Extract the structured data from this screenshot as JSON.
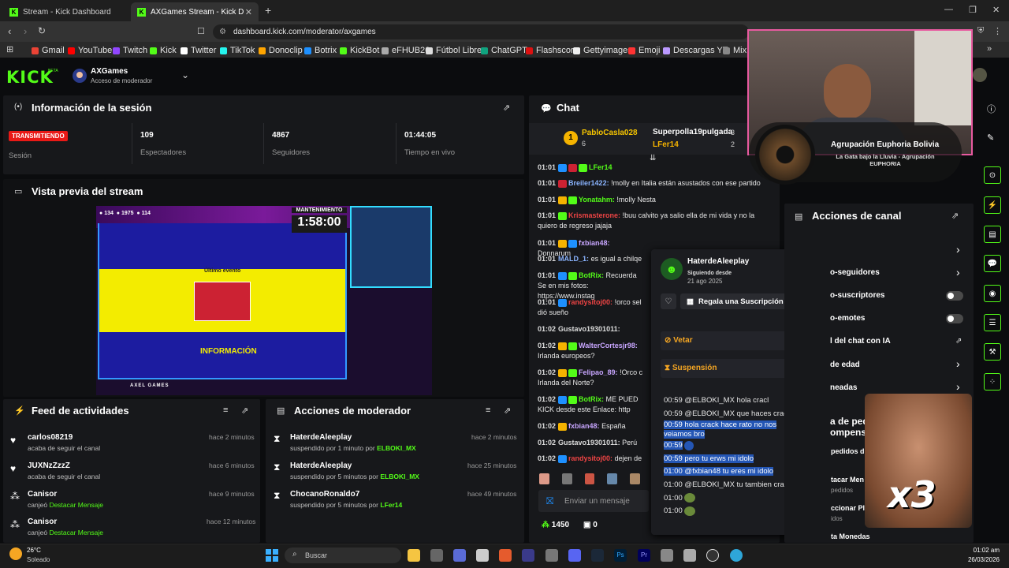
{
  "browser": {
    "tabs": [
      {
        "title": "Stream - Kick Dashboard"
      },
      {
        "title": "AXGames Stream - Kick Dashbo"
      }
    ],
    "url": "dashboard.kick.com/moderator/axgames",
    "bookmarks": [
      "Gmail",
      "YouTube",
      "Twitch",
      "Kick",
      "Twitter",
      "TikTok",
      "Donoclip",
      "Botrix",
      "KickBot",
      "eFHUB26",
      "Fútbol Libre",
      "ChatGPT",
      "Flashscore",
      "Gettyimages",
      "Emoji",
      "Descargas YT",
      "Mix N"
    ]
  },
  "header": {
    "logo": "KICK",
    "logo_tag": "BETA",
    "channel": "AXGames",
    "role": "Acceso de moderador"
  },
  "session": {
    "title": "Información de la sesión",
    "status_badge": "TRANSMITIENDO",
    "status_label": "Sesión",
    "viewers": "109",
    "viewers_label": "Espectadores",
    "followers": "4867",
    "followers_label": "Seguidores",
    "uptime": "01:44:05",
    "uptime_label": "Tiempo en vivo"
  },
  "preview": {
    "title": "Vista previa del stream",
    "stat1": "134",
    "stat2": "1975",
    "stat3": "114",
    "maint_label": "MANTENIMIENTO",
    "maint_timer": "1:58:00",
    "last_event": "Último evento",
    "info": "INFORMACIÓN",
    "footer": "AXEL GAMES"
  },
  "feed": {
    "title": "Feed de actividades",
    "items": [
      {
        "user": "carlos08219",
        "action": "acaba de seguir el canal",
        "highlight": "",
        "time": "hace 2 minutos"
      },
      {
        "user": "JUXNzZzzZ",
        "action": "acaba de seguir el canal",
        "highlight": "",
        "time": "hace 6 minutos"
      },
      {
        "user": "Canisor",
        "action": "canjeó",
        "highlight": "Destacar Mensaje",
        "time": "hace 9 minutos"
      },
      {
        "user": "Canisor",
        "action": "canjeó",
        "highlight": "Destacar Mensaje",
        "time": "hace 12 minutos"
      }
    ]
  },
  "modactions": {
    "title": "Acciones de moderador",
    "items": [
      {
        "user": "HaterdeAleeplay",
        "action": "suspendido por 1 minuto por",
        "by": "ELBOKI_MX",
        "time": "hace 2 minutos"
      },
      {
        "user": "HaterdeAleeplay",
        "action": "suspendido por 5 minutos por",
        "by": "ELBOKI_MX",
        "time": "hace 25 minutos"
      },
      {
        "user": "ChocanoRonaldo7",
        "action": "suspendido por 5 minutos por",
        "by": "LFer14",
        "time": "hace 49 minutos"
      }
    ]
  },
  "chat": {
    "title": "Chat",
    "leaders": {
      "first": "PabloCasla028",
      "first_count": "6",
      "second": "Superpolla19pulgada",
      "second_count": "3",
      "third": "LFer14",
      "third_count": "2"
    },
    "messages": [
      {
        "time": "01:01",
        "user": "LFer14",
        "text": ""
      },
      {
        "time": "01:01",
        "user": "Breiler1422:",
        "text": "!molly en Italia están asustados con ese partido"
      },
      {
        "time": "01:01",
        "user": "Yonatahm:",
        "text": "!molly Nesta"
      },
      {
        "time": "01:01",
        "user": "Krismasterone:",
        "text": "!buu calvito ya salio ella de mi vida y no la quiero de regreso jajaja"
      },
      {
        "time": "01:01",
        "user": "fxbian48:",
        "text": "Donnarum"
      },
      {
        "time": "01:01",
        "user": "MALD_1:",
        "text": "es igual a chilqe"
      },
      {
        "time": "01:01",
        "user": "BotRix:",
        "text": "Recuerda Se en mis fotos: https://www.instag"
      },
      {
        "time": "01:01",
        "user": "randysitoj00:",
        "text": "!orco sel dió sueño"
      },
      {
        "time": "01:02",
        "user": "Gustavo19301011:",
        "text": ""
      },
      {
        "time": "01:02",
        "user": "WalterCortesjr98:",
        "text": "Irlanda europeos?"
      },
      {
        "time": "01:02",
        "user": "Felipao_89:",
        "text": "!Orco c Irlanda del Norte?"
      },
      {
        "time": "01:02",
        "user": "BotRix:",
        "text": "ME PUED KICK desde este Enlace: http"
      },
      {
        "time": "01:02",
        "user": "fxbian48:",
        "text": "España"
      },
      {
        "time": "01:02",
        "user": "Gustavo19301011:",
        "text": "Perú"
      },
      {
        "time": "01:02",
        "user": "randysitoj00:",
        "text": "dejen de"
      }
    ],
    "input_placeholder": "Enviar un mensaje",
    "points": "1450",
    "gifts": "0"
  },
  "usercard": {
    "username": "HaterdeAleeplay",
    "following_label": "Siguiendo desde",
    "following_date": "21 ago 2025",
    "gift_label": "Regala una Suscripción",
    "ban_label": "Vetar",
    "timeout_label": "Suspensión",
    "history": [
      {
        "time": "00:59",
        "text": "@ELBOKI_MX hola cracl"
      },
      {
        "time": "00:59",
        "text": "@ELBOKI_MX que haces crack"
      },
      {
        "time": "00:59",
        "text": "hola crack hace rato no nos veiamos bro"
      },
      {
        "time": "00:59",
        "text": ""
      },
      {
        "time": "00:59",
        "text": "pero tu erws mi idolo"
      },
      {
        "time": "01:00",
        "text": "@fxbian48 tu eres mi idolo"
      },
      {
        "time": "01:00",
        "text": "@ELBOKI_MX tu tambien crack"
      },
      {
        "time": "01:00",
        "text": ""
      },
      {
        "time": "01:00",
        "text": ""
      }
    ]
  },
  "channel_actions": {
    "title": "Acciones de canal",
    "items": [
      "o-seguidores",
      "o-suscriptores",
      "o-emotes",
      "l del chat con IA",
      "de edad",
      "neadas"
    ],
    "partial": [
      "a de ped",
      "ompens",
      "pedidos d",
      "tacar Men",
      "pedidos",
      "ccionar Plantilla",
      "idos",
      "ta Monedas"
    ]
  },
  "music": {
    "artist": "Agrupación Euphoria Bolivia",
    "track": "La Gata bajo la Lluvia - Agrupación EUPHORIA"
  },
  "overlay": {
    "multiplier": "x3"
  },
  "taskbar": {
    "temp": "26°C",
    "weather": "Soleado",
    "search": "Buscar",
    "time": "01:02 am",
    "date": "26/03/2026"
  },
  "colors": {
    "accent": "#53fc18",
    "live": "#e91916",
    "bg": "#0b0c0e",
    "panel": "#17181b",
    "selection": "#2456b5"
  }
}
